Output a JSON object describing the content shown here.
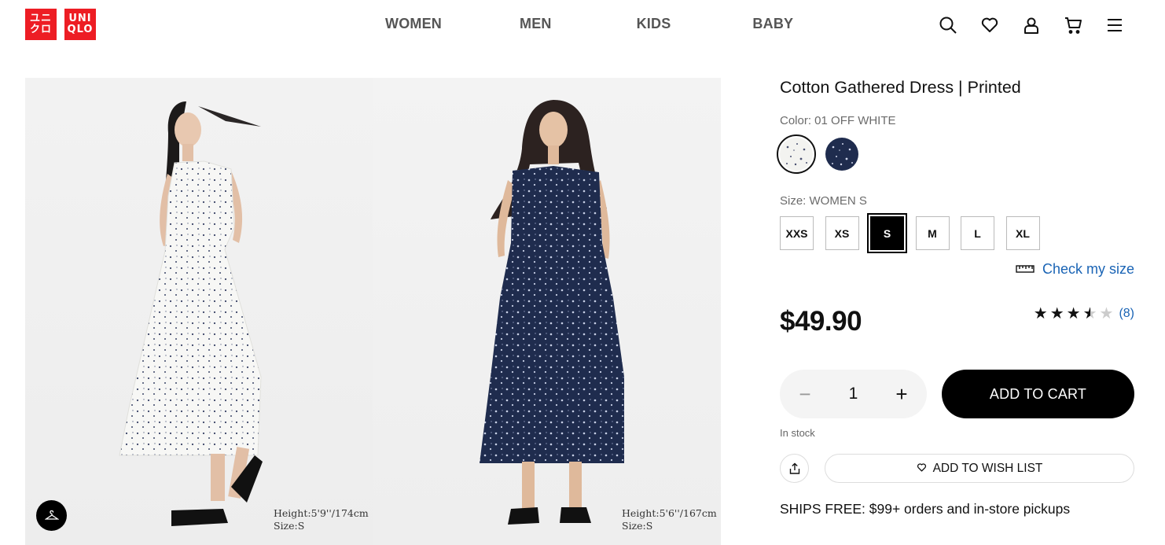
{
  "brand": {
    "logo_left": [
      "ユニ",
      "クロ"
    ],
    "logo_right": [
      "UNI",
      "QLO"
    ],
    "color": "#ed1d24"
  },
  "nav": {
    "items": [
      "WOMEN",
      "MEN",
      "KIDS",
      "BABY"
    ]
  },
  "header_icons": [
    "search-icon",
    "heart-icon",
    "account-icon",
    "cart-icon",
    "menu-icon"
  ],
  "gallery": {
    "photos": [
      {
        "dress_color": "off-white print",
        "caption_height": "Height:5'9''/174cm",
        "caption_size": "Size:S"
      },
      {
        "dress_color": "navy print",
        "caption_height": "Height:5'6''/167cm",
        "caption_size": "Size:S"
      }
    ],
    "fit_button_icon": "hanger-icon"
  },
  "product": {
    "title": "Cotton Gathered Dress | Printed",
    "color_label": "Color: 01 OFF WHITE",
    "swatches": [
      {
        "name": "01 OFF WHITE",
        "color": "#f2f2ef",
        "selected": true
      },
      {
        "name": "NAVY",
        "color": "#1f2c4e",
        "selected": false
      }
    ],
    "size_label": "Size: WOMEN S",
    "sizes": [
      {
        "label": "XXS",
        "selected": false
      },
      {
        "label": "XS",
        "selected": false
      },
      {
        "label": "S",
        "selected": true
      },
      {
        "label": "M",
        "selected": false
      },
      {
        "label": "L",
        "selected": false
      },
      {
        "label": "XL",
        "selected": false
      }
    ],
    "check_size": "Check my size",
    "price": "$49.90",
    "rating": {
      "value": 3.5,
      "max": 5,
      "count_text": "(8)"
    },
    "quantity": "1",
    "qty_minus": "−",
    "qty_plus": "+",
    "add_to_cart": "ADD TO CART",
    "stock": "In stock",
    "wish_list": "ADD TO WISH LIST",
    "shipping": "SHIPS FREE: $99+ orders and in-store pickups"
  }
}
